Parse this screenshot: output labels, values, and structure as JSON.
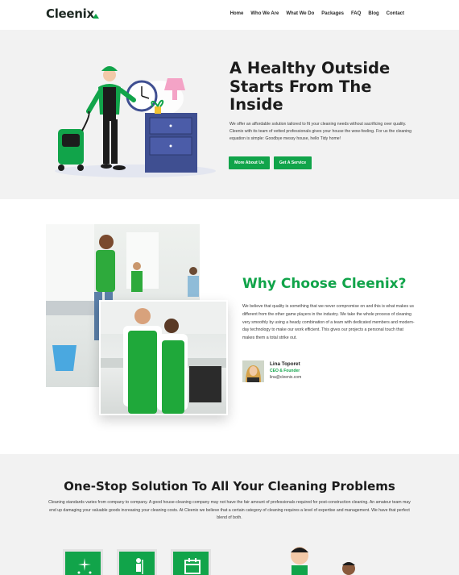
{
  "header": {
    "logo": "Cleenix",
    "nav": [
      "Home",
      "Who We Are",
      "What We Do",
      "Packages",
      "FAQ",
      "Blog",
      "Contact"
    ]
  },
  "hero": {
    "title": "A Healthy Outside Starts From The Inside",
    "text": "We offer an affordable solution tailored to fit your cleaning needs without sacrificing over quality. Cleenix with its team of vetted professionals gives your house the wow-feeling. For us the cleaning equation is simple: Goodbye messy house, hello Tidy home!",
    "button_about": "More About Us",
    "button_service": "Get A Service"
  },
  "why": {
    "title": "Why Choose Cleenix?",
    "text": "We believe that quality is something that we never compromise on and this is what makes us different from the other game players in the industry. We take the whole process of cleaning very smoothly by using a heady combination of a team with dedicated members and modern-day technology to make our work efficient. This gives our projects a personal touch that makes them a total strike out.",
    "author_name": "Lina Toporet",
    "author_role": "CEO & Founder",
    "author_email": "lina@cleenix.com"
  },
  "services": {
    "title": "One-Stop Solution To All Your Cleaning Problems",
    "text": "Cleaning standards varies from company to company. A good house-cleaning company may not have the fair amount of professionals required for post-construction cleaning. An amateur team may end up damaging your valuable goods increasing your cleaning costs. At Cleenix we believe that a certain category of cleaning requires a level of expertise and management. We have that perfect blend of both.",
    "icons": [
      "sparkle-spray-icon",
      "cleaner-person-icon",
      "calendar-icon"
    ]
  },
  "colors": {
    "accent": "#11a44a",
    "dark": "#1c1c1c",
    "section_bg": "#f2f2f2"
  }
}
